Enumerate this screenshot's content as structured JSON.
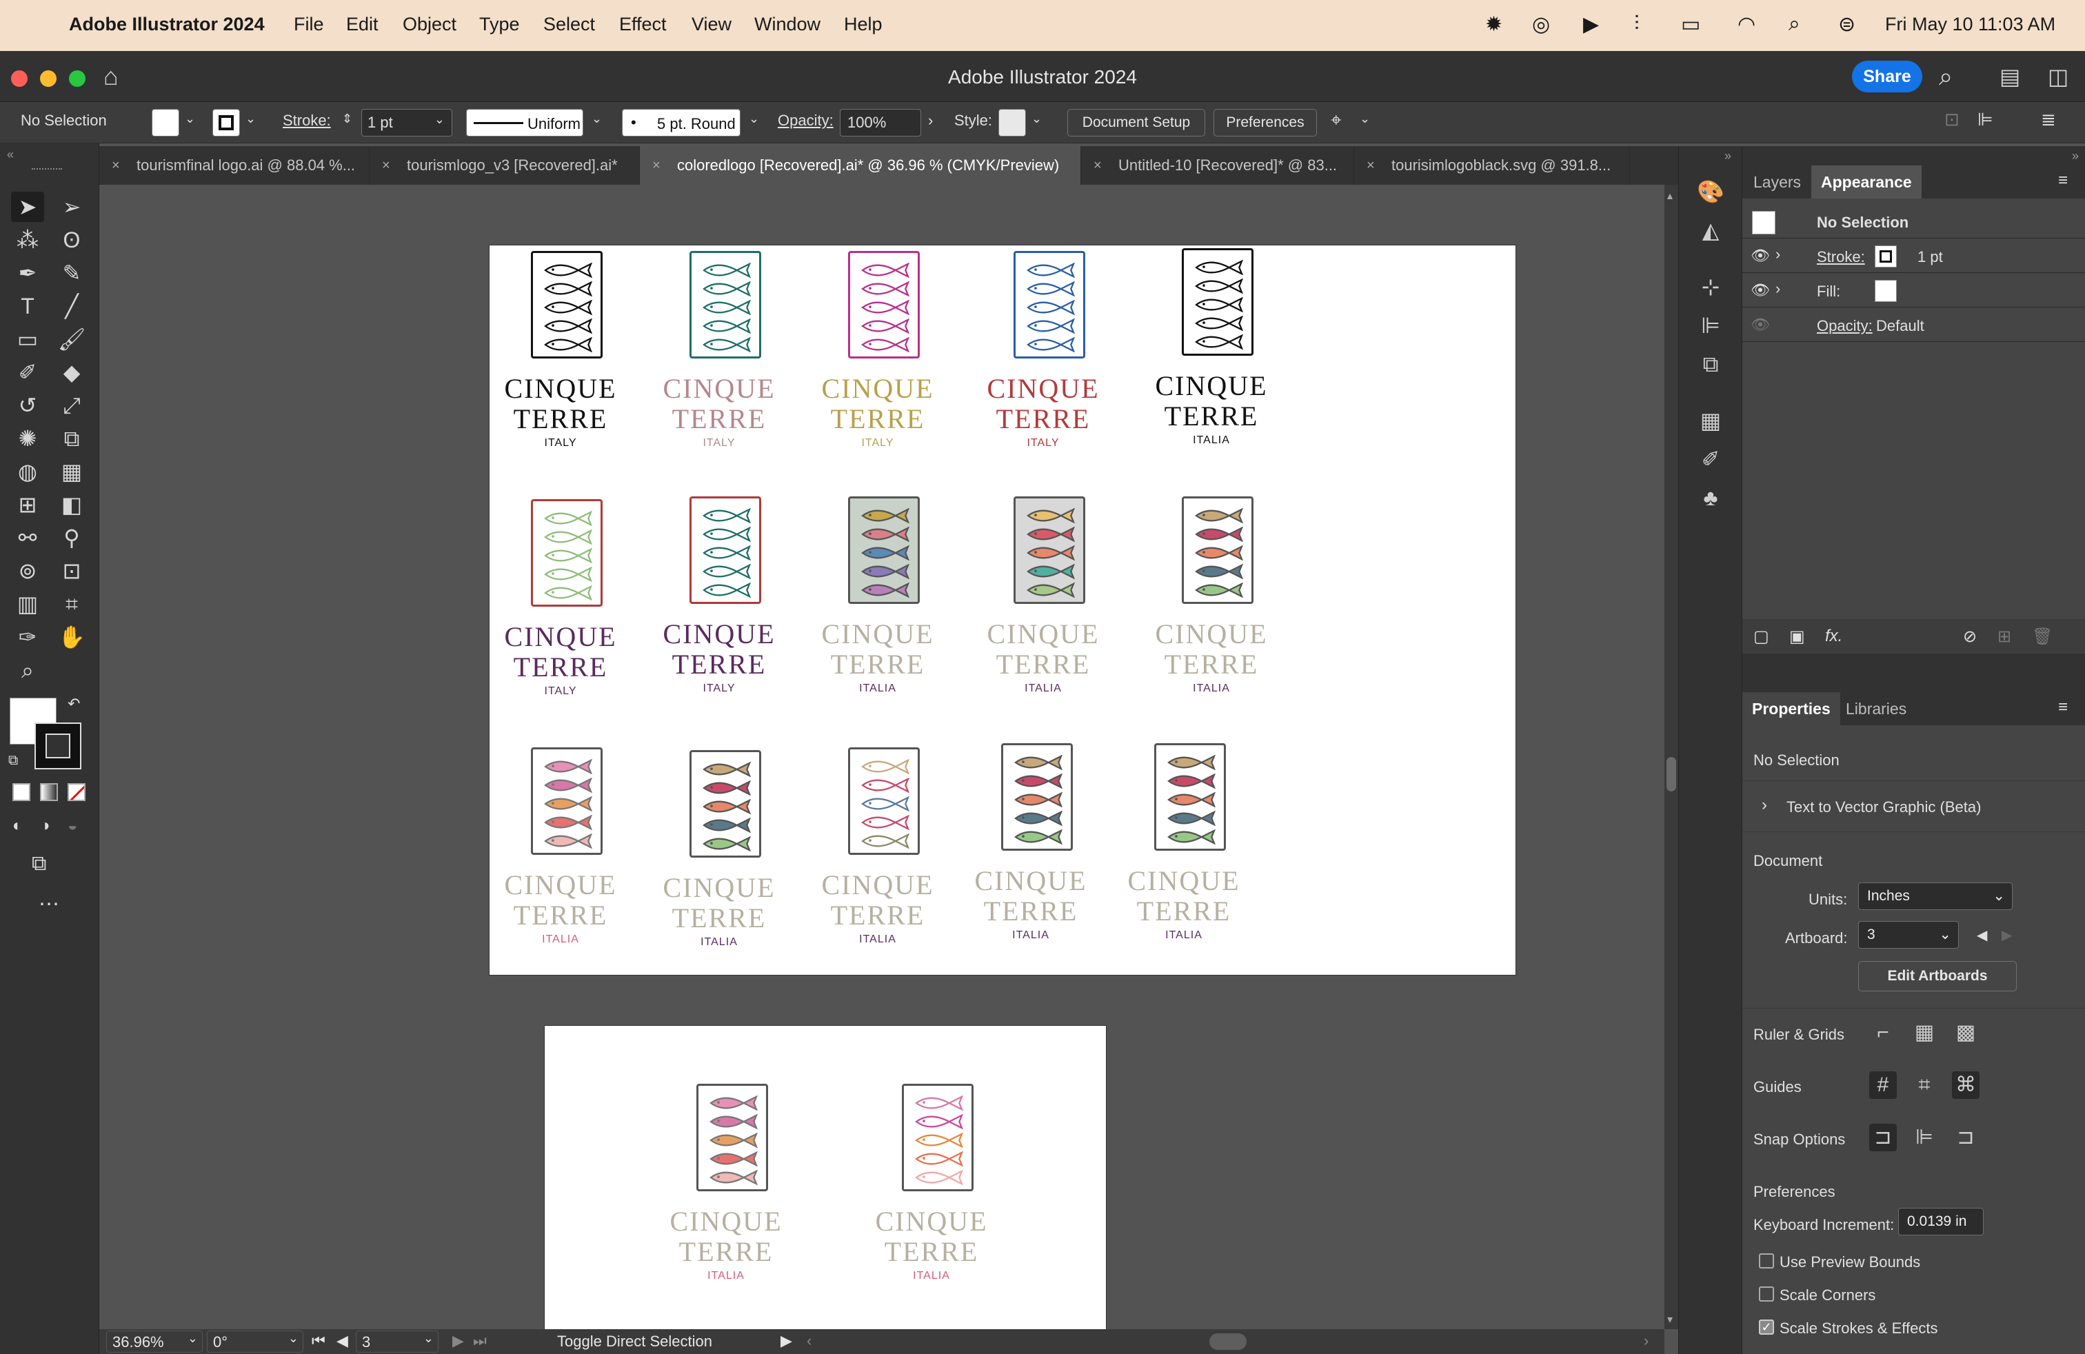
{
  "menubar": {
    "app_name": "Adobe Illustrator 2024",
    "items": [
      "File",
      "Edit",
      "Object",
      "Type",
      "Select",
      "Effect",
      "View",
      "Window",
      "Help"
    ],
    "clock": "Fri May 10  11:03 AM"
  },
  "window": {
    "title": "Adobe Illustrator 2024",
    "share_label": "Share"
  },
  "control_bar": {
    "selection": "No Selection",
    "stroke_label": "Stroke:",
    "stroke_value": "1 pt",
    "profile": "Uniform",
    "brush": "5 pt. Round",
    "opacity_label": "Opacity:",
    "opacity_value": "100%",
    "style_label": "Style:",
    "document_setup": "Document Setup",
    "preferences": "Preferences"
  },
  "tabs": [
    {
      "label": "tourismfinal logo.ai @ 88.04 %..."
    },
    {
      "label": "tourismlogo_v3 [Recovered].ai*"
    },
    {
      "label": "coloredlogo [Recovered].ai* @ 36.96 % (CMYK/Preview)"
    },
    {
      "label": "Untitled-10 [Recovered]* @ 83..."
    },
    {
      "label": "tourisimlogoblack.svg @ 391.8..."
    }
  ],
  "logos": {
    "line1": "CINQUE",
    "line2": "TERRE",
    "italy": "ITALY",
    "italia": "ITALIA"
  },
  "status_bar": {
    "zoom": "36.96%",
    "rotation": "0°",
    "artboard": "3",
    "tool_hint": "Toggle Direct Selection"
  },
  "appearance_panel": {
    "tabs": [
      "Layers",
      "Appearance"
    ],
    "selection": "No Selection",
    "stroke_label": "Stroke:",
    "stroke_value": "1 pt",
    "fill_label": "Fill:",
    "opacity_label": "Opacity:",
    "opacity_value": "Default"
  },
  "properties_panel": {
    "tabs": [
      "Properties",
      "Libraries"
    ],
    "selection": "No Selection",
    "text_to_vector": "Text to Vector Graphic (Beta)",
    "document_heading": "Document",
    "units_label": "Units:",
    "units_value": "Inches",
    "artboard_label": "Artboard:",
    "artboard_value": "3",
    "edit_artboards": "Edit Artboards",
    "ruler_grids": "Ruler & Grids",
    "guides": "Guides",
    "snap_options": "Snap Options",
    "preferences_heading": "Preferences",
    "keyboard_increment_label": "Keyboard Increment:",
    "keyboard_increment_value": "0.0139 in",
    "use_preview_bounds": "Use Preview Bounds",
    "scale_corners": "Scale Corners",
    "scale_strokes_effects": "Scale Strokes & Effects",
    "use_preview_bounds_checked": false,
    "scale_corners_checked": false,
    "scale_strokes_effects_checked": true
  },
  "colors": {
    "accent": "#1473e6",
    "menubar_bg": "#f3dfca",
    "panel_bg": "#323232",
    "canvas_bg": "#535353"
  }
}
